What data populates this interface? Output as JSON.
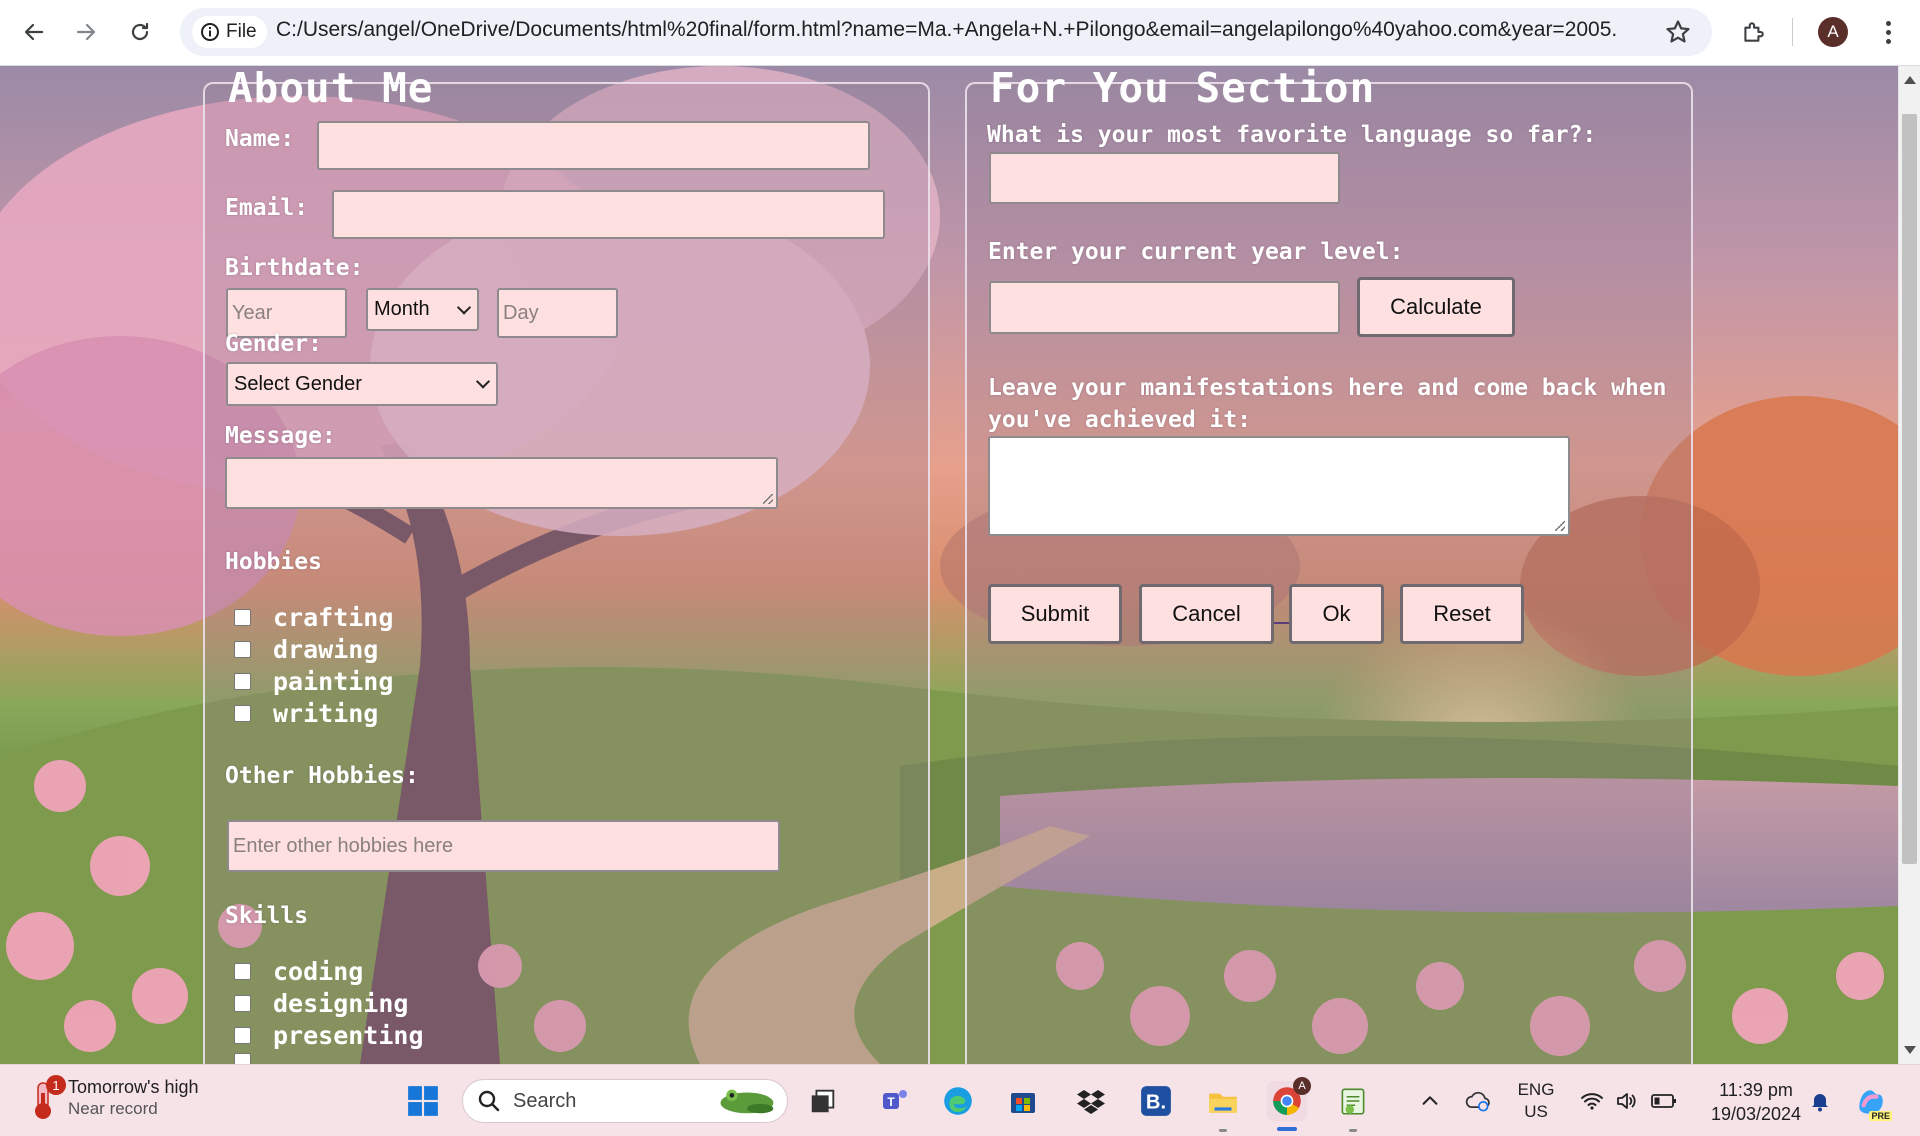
{
  "browser": {
    "site_chip_label": "File",
    "url": "C:/Users/angel/OneDrive/Documents/html%20final/form.html?name=Ma.+Angela+N.+Pilongo&email=angelapilongo%40yahoo.com&year=2005...",
    "avatar_initial": "A"
  },
  "about": {
    "legend": "About Me",
    "name_label": "Name:",
    "name_value": "",
    "email_label": "Email:",
    "email_value": "",
    "birthdate_label": "Birthdate:",
    "year_placeholder": "Year",
    "month_selected": "Month",
    "day_placeholder": "Day",
    "gender_label": "Gender:",
    "gender_selected": "Select Gender",
    "message_label": "Message:",
    "message_value": "",
    "hobbies_title": "Hobbies",
    "hobbies": [
      "crafting",
      "drawing",
      "painting",
      "writing"
    ],
    "other_hobbies_label": "Other Hobbies:",
    "other_hobbies_placeholder": "Enter other hobbies here",
    "skills_title": "Skills",
    "skills": [
      "coding",
      "designing",
      "presenting"
    ]
  },
  "foryou": {
    "legend": "For You Section",
    "language_label": "What is your most favorite language so far?:",
    "language_value": "",
    "year_level_label": "Enter your current year level:",
    "year_level_value": "",
    "calculate_button": "Calculate",
    "manifest_label": "Leave your manifestations here and come back when you've achieved it:",
    "manifest_value": "",
    "buttons": {
      "submit": "Submit",
      "cancel": "Cancel",
      "ok": "Ok",
      "reset": "Reset"
    }
  },
  "taskbar": {
    "weather_badge": "1",
    "weather_line1": "Tomorrow's high",
    "weather_line2": "Near record",
    "search_label": "Search",
    "lang_line1": "ENG",
    "lang_line2": "US",
    "time": "11:39 pm",
    "date": "19/03/2024",
    "copilot_badge": "PRE"
  },
  "colors": {
    "field_bg": "#fde0df",
    "panel_border": "#ebe1eb",
    "taskbar_bg": "#f6e3e8",
    "accent": "#2f6fd6"
  },
  "icons": [
    "back-arrow-icon",
    "forward-arrow-icon",
    "reload-icon",
    "info-icon",
    "star-icon",
    "extensions-icon",
    "menu-icon",
    "windows-start-icon",
    "search-icon",
    "teams-icon",
    "edge-icon",
    "store-icon",
    "dropbox-icon",
    "file-explorer-icon",
    "chrome-icon",
    "notepad-icon",
    "chevron-up-icon",
    "cloud-sync-icon",
    "wifi-icon",
    "volume-icon",
    "battery-icon",
    "bell-icon",
    "copilot-icon"
  ]
}
